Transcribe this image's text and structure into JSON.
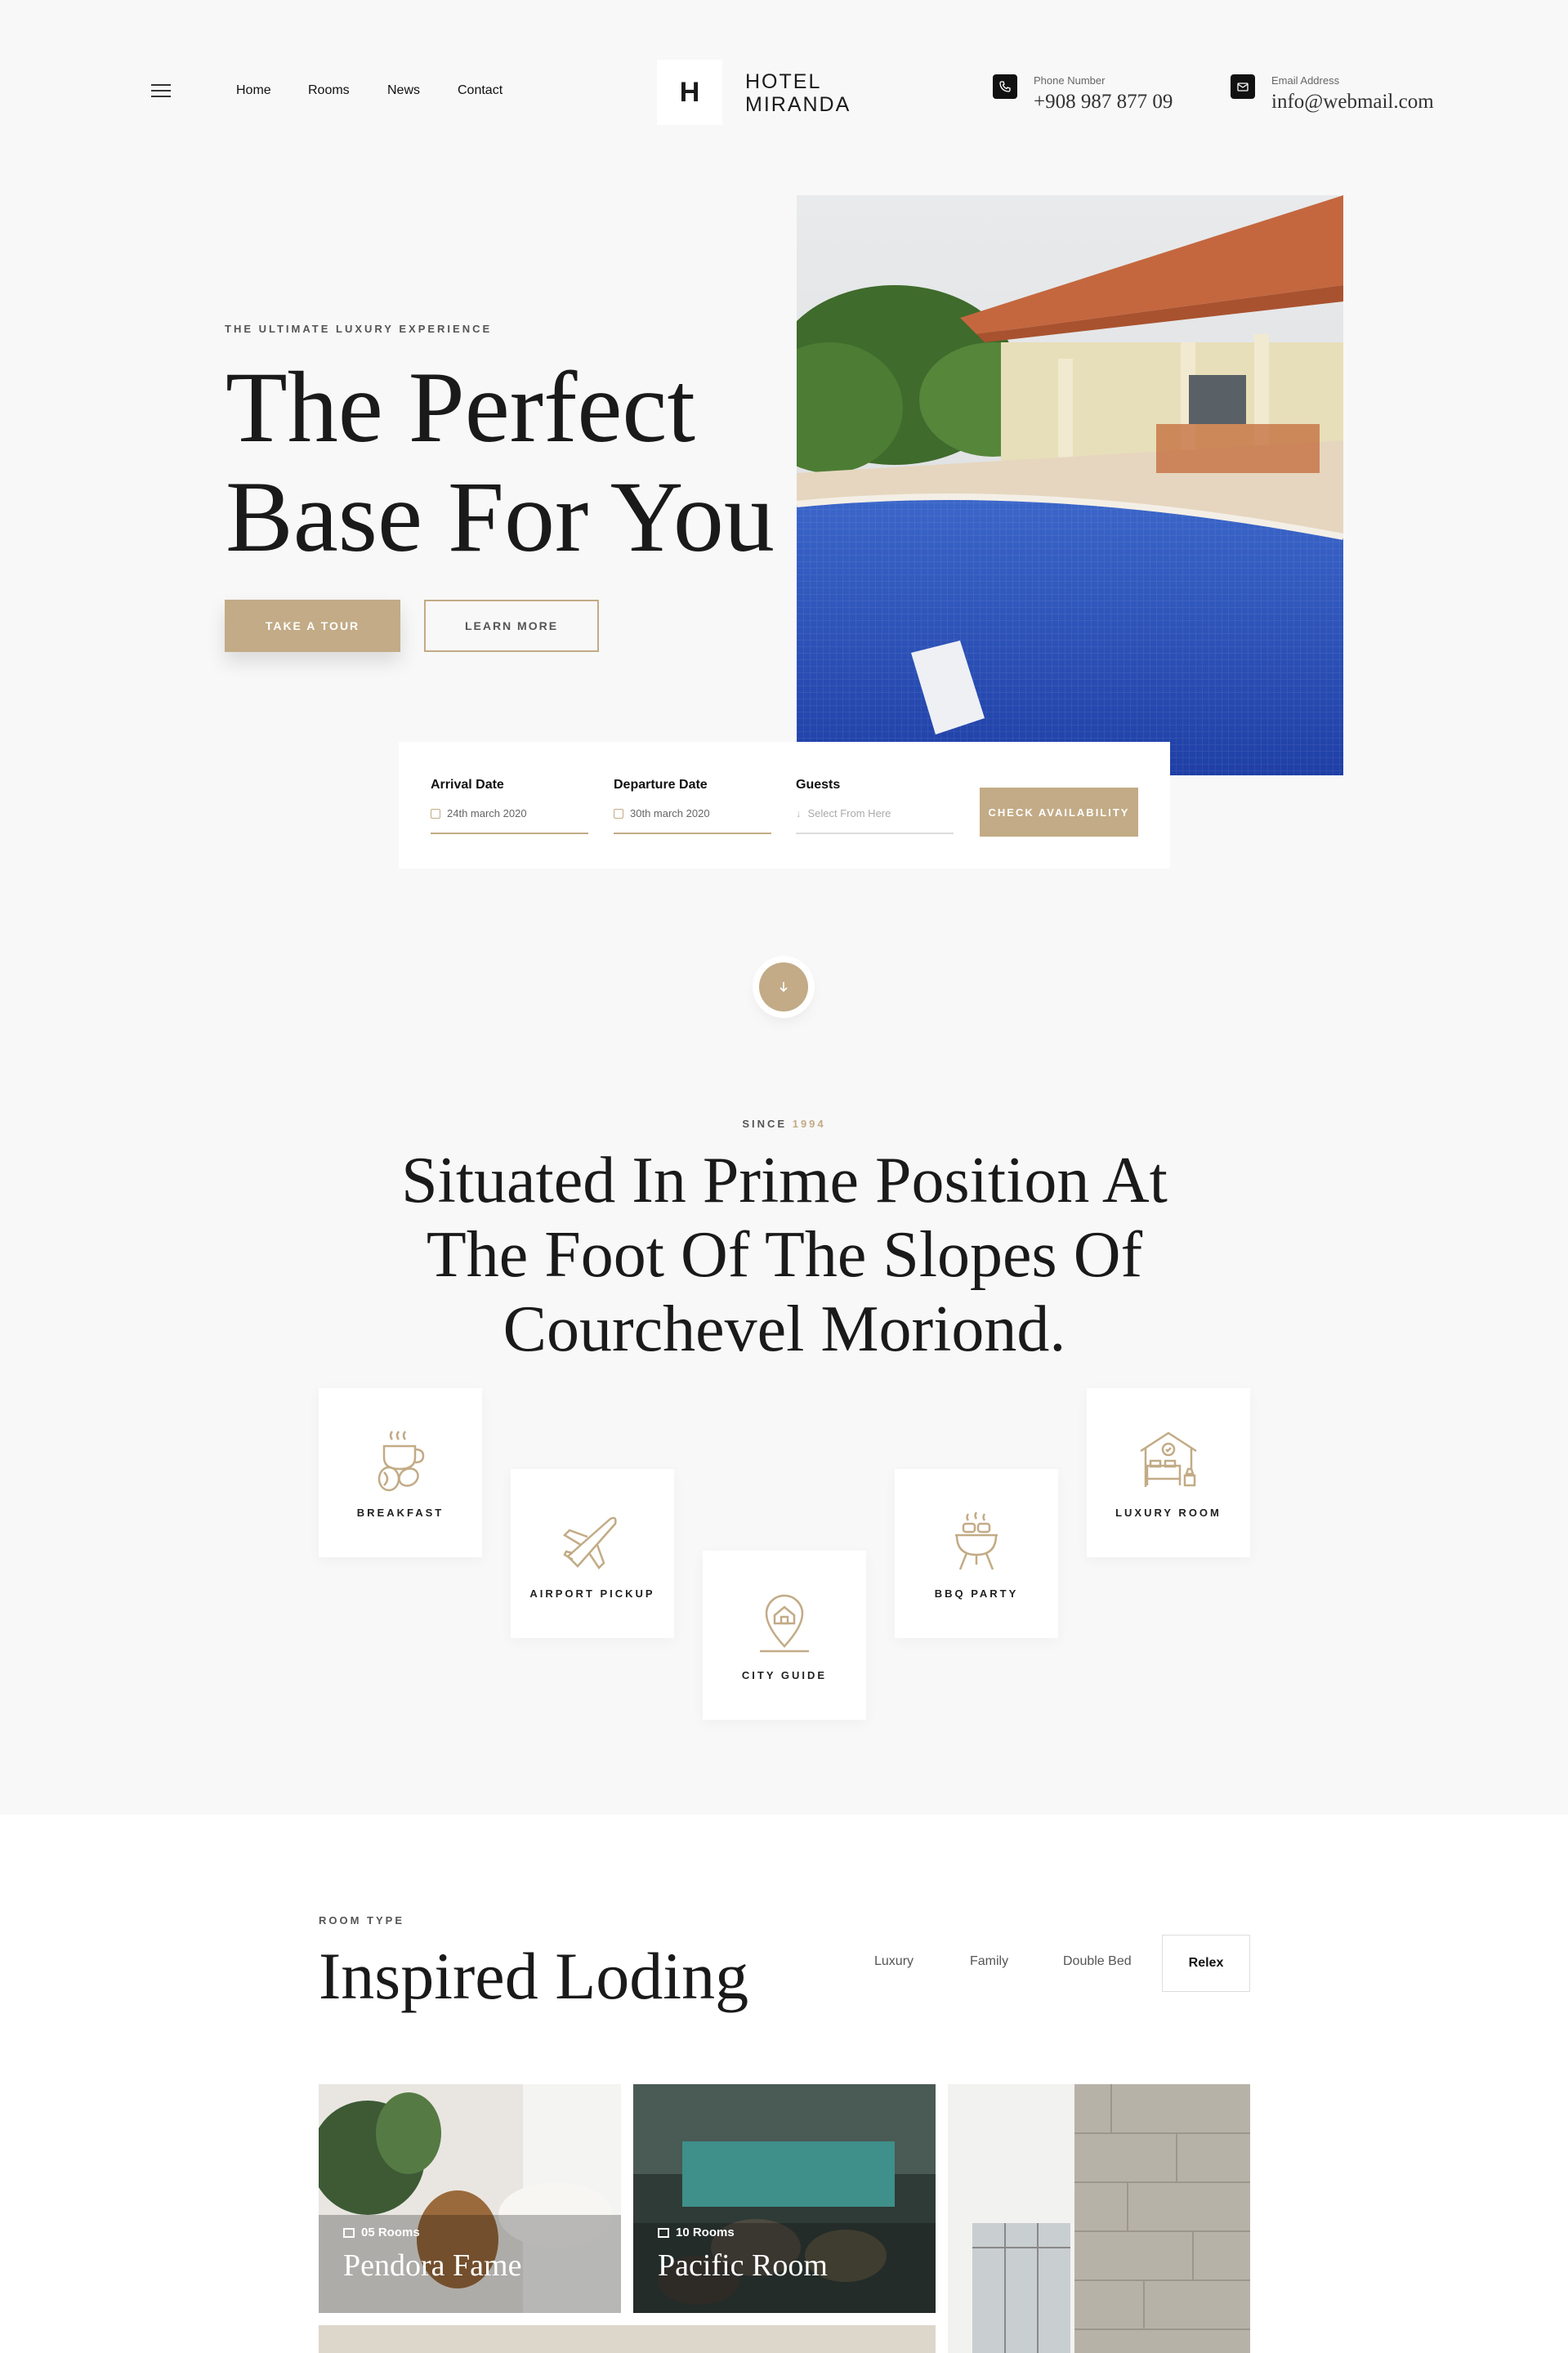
{
  "header": {
    "nav": [
      "Home",
      "Rooms",
      "News",
      "Contact"
    ],
    "logo_letter": "H",
    "logo_line1": "HOTEL",
    "logo_line2": "MIRANDA",
    "phone_label": "Phone Number",
    "phone_value": "+908 987 877 09",
    "email_label": "Email Address",
    "email_value": "info@webmail.com"
  },
  "hero": {
    "eyebrow": "THE ULTIMATE LUXURY EXPERIENCE",
    "title_line1": "The Perfect",
    "title_line2": "Base For You",
    "primary_button": "TAKE A TOUR",
    "secondary_button": "LEARN MORE"
  },
  "booking": {
    "arrival_label": "Arrival Date",
    "arrival_value": "24th march 2020",
    "departure_label": "Departure Date",
    "departure_value": "30th march 2020",
    "guests_label": "Guests",
    "guests_placeholder": "Select From Here",
    "check_button": "CHECK AVAILABILITY"
  },
  "about": {
    "since_label": "SINCE",
    "since_year": "1994",
    "title_line1": "Situated In Prime Position At",
    "title_line2": "The Foot Of The Slopes Of",
    "title_line3": "Courchevel Moriond.",
    "features": [
      {
        "label": "BREAKFAST",
        "icon": "coffee-icon"
      },
      {
        "label": "AIRPORT PICKUP",
        "icon": "airplane-icon"
      },
      {
        "label": "CITY GUIDE",
        "icon": "location-pin-icon"
      },
      {
        "label": "BBQ PARTY",
        "icon": "bbq-grill-icon"
      },
      {
        "label": "LUXURY ROOM",
        "icon": "bedroom-icon"
      }
    ]
  },
  "rooms": {
    "eyebrow": "ROOM TYPE",
    "title": "Inspired Loding",
    "tabs": [
      "Luxury",
      "Family",
      "Double Bed",
      "Relex"
    ],
    "active_tab": "Relex",
    "cards": [
      {
        "count": "05 Rooms",
        "name": "Pendora Fame"
      },
      {
        "count": "10 Rooms",
        "name": "Pacific Room"
      }
    ]
  },
  "colors": {
    "accent": "#c2ab86",
    "background": "#f8f8f8",
    "text": "#1a1a1a"
  }
}
